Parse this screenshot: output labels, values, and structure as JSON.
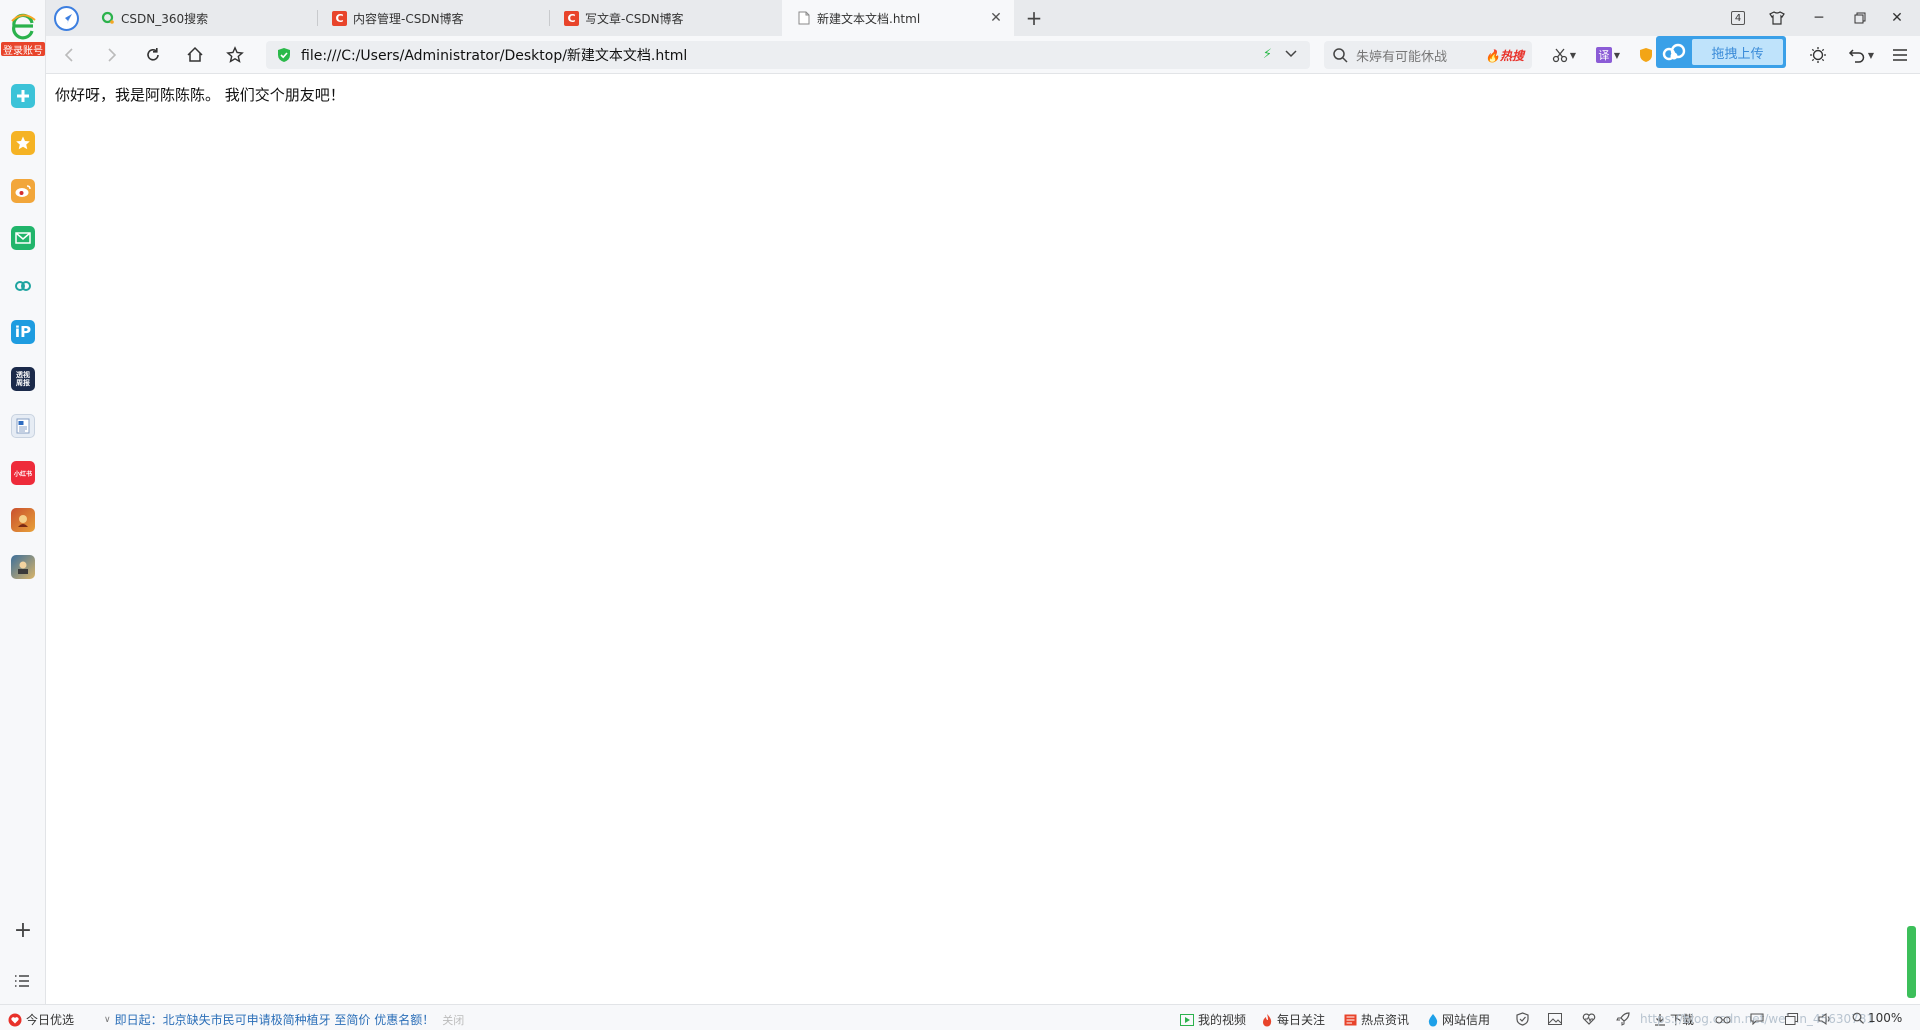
{
  "tabs": [
    {
      "title": "CSDN_360搜索",
      "icon": "360-search-icon"
    },
    {
      "title": "内容管理-CSDN博客",
      "icon": "csdn-icon"
    },
    {
      "title": "写文章-CSDN博客",
      "icon": "csdn-icon"
    },
    {
      "title": "新建文本文档.html",
      "icon": "document-icon",
      "active": true
    }
  ],
  "tab_count": "4",
  "csdn_letter": "C",
  "address": {
    "url": "file:///C:/Users/Administrator/Desktop/新建文本文档.html"
  },
  "search": {
    "placeholder": "朱婷有可能休战",
    "hot_label": "热搜"
  },
  "translate_label": "译",
  "cloud_upload_label": "拖拽上传",
  "sidebar": {
    "login_label": "登录账号",
    "apps": [
      {
        "icon": "health-plus-icon",
        "color": "#3cc3d8"
      },
      {
        "icon": "favorites-star-icon",
        "color": "#f5b324"
      },
      {
        "icon": "weibo-icon",
        "color": "#f2a63a"
      },
      {
        "icon": "mail-icon",
        "color": "#21b56b"
      },
      {
        "icon": "cloud-link-icon",
        "color": "#1fa4a0"
      },
      {
        "icon": "p-app-icon",
        "color": "#1e9ce0"
      },
      {
        "icon": "news-app-icon",
        "color": "#1b2a4a",
        "text": "透视\n周报"
      },
      {
        "icon": "word-doc-icon",
        "color": "#e6ecf4"
      },
      {
        "icon": "xiaohongshu-icon",
        "color": "#ee2b3a",
        "text": "小红书"
      },
      {
        "icon": "game-icon-1",
        "color": "#c9502e"
      },
      {
        "icon": "game-icon-2",
        "color": "#3d6f9a"
      }
    ]
  },
  "page": {
    "text": "你好呀，我是阿陈陈陈。 我们交个朋友吧！"
  },
  "statusbar": {
    "today_pick": "今日优选",
    "news": "即日起：北京缺失市民可申请极简种植牙 至简价 优惠名额！",
    "news_close": "关闭",
    "my_video": "我的视频",
    "daily_follow": "每日关注",
    "hot_news": "热点资讯",
    "site_credit": "网站信用",
    "download": "下载",
    "watermark": "https://blog.csdn.net/weixin_45630781",
    "zoom": "100%"
  }
}
